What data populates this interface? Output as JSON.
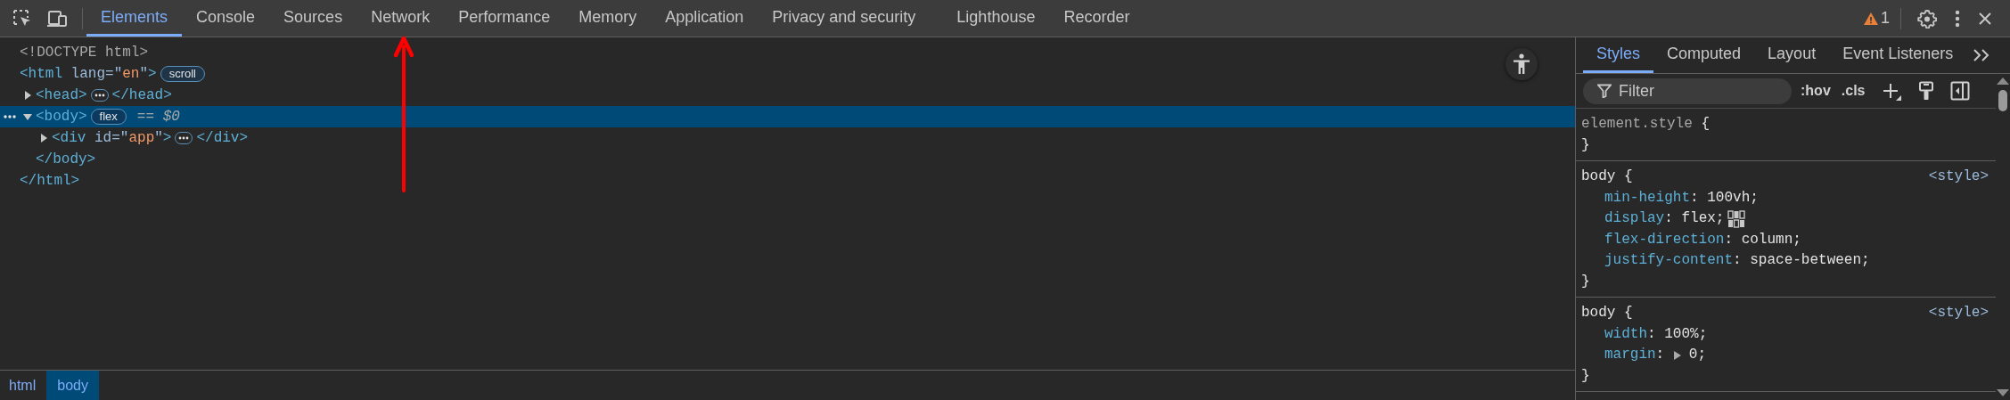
{
  "toolbar": {
    "tabs": [
      {
        "label": "Elements",
        "selected": true
      },
      {
        "label": "Console",
        "selected": false
      },
      {
        "label": "Sources",
        "selected": false
      },
      {
        "label": "Network",
        "selected": false
      },
      {
        "label": "Performance",
        "selected": false
      },
      {
        "label": "Memory",
        "selected": false
      },
      {
        "label": "Application",
        "selected": false
      },
      {
        "label": "Privacy and security",
        "selected": false
      },
      {
        "label": "Lighthouse",
        "selected": false
      },
      {
        "label": "Recorder",
        "selected": false
      }
    ],
    "issues": "1"
  },
  "dom_tree": [
    {
      "items": [
        {
          "kind": "code",
          "segments": [
            {
              "kind": "comment",
              "text": "<!DOCTYPE html>"
            }
          ]
        }
      ],
      "selected": false
    },
    {
      "items": [
        {
          "kind": "code",
          "segments": [
            {
              "kind": "tag",
              "text": "<html"
            },
            {
              "kind": "attr",
              "text": " lang"
            },
            {
              "kind": "punct",
              "text": "=\""
            },
            {
              "kind": "value",
              "text": "en"
            },
            {
              "kind": "punct",
              "text": "\""
            },
            {
              "kind": "tag",
              "text": ">"
            }
          ]
        },
        {
          "kind": "badge",
          "text": "scroll"
        }
      ],
      "selected": false,
      "children": [
        {
          "expanded": false,
          "selected": false,
          "items": [
            {
              "kind": "code",
              "segments": [
                {
                  "kind": "tag",
                  "text": "<head>"
                }
              ]
            },
            {
              "kind": "ellipsis"
            },
            {
              "kind": "code",
              "segments": [
                {
                  "kind": "tag",
                  "text": "</head>"
                }
              ]
            }
          ]
        },
        {
          "expanded": true,
          "selected": true,
          "items": [
            {
              "kind": "code",
              "segments": [
                {
                  "kind": "tag",
                  "text": "<body>"
                }
              ]
            },
            {
              "kind": "badge",
              "text": "flex"
            },
            {
              "kind": "ref",
              "text": "== $0"
            }
          ],
          "children": [
            {
              "expanded": false,
              "selected": false,
              "items": [
                {
                  "kind": "code",
                  "segments": [
                    {
                      "kind": "tag",
                      "text": "<div"
                    },
                    {
                      "kind": "attr",
                      "text": " id"
                    },
                    {
                      "kind": "punct",
                      "text": "=\""
                    },
                    {
                      "kind": "value",
                      "text": "app"
                    },
                    {
                      "kind": "punct",
                      "text": "\""
                    },
                    {
                      "kind": "tag",
                      "text": ">"
                    }
                  ]
                },
                {
                  "kind": "ellipsis"
                },
                {
                  "kind": "code",
                  "segments": [
                    {
                      "kind": "tag",
                      "text": "</div>"
                    }
                  ]
                }
              ]
            }
          ],
          "closing": [
            {
              "kind": "tag",
              "text": "</body>"
            }
          ]
        }
      ],
      "closing": [
        {
          "kind": "tag",
          "text": "</html>"
        }
      ]
    }
  ],
  "breadcrumbs": [
    {
      "label": "html",
      "selected": false
    },
    {
      "label": "body",
      "selected": true
    }
  ],
  "sidebar": {
    "tabs": [
      {
        "label": "Styles",
        "selected": true
      },
      {
        "label": "Computed",
        "selected": false
      },
      {
        "label": "Layout",
        "selected": false
      },
      {
        "label": "Event Listeners",
        "selected": false
      }
    ],
    "filter": {
      "placeholder": "Filter"
    },
    "toggles": [
      ":hov",
      ".cls"
    ],
    "rules": [
      {
        "kind": "inline",
        "selector": "element.style",
        "open": "{",
        "close": "}"
      },
      {
        "kind": "sheet",
        "selector": "body",
        "open": "{",
        "close": "}",
        "source": "<style>",
        "declarations": [
          {
            "kind": "plain",
            "property": "min-height",
            "colon": ":",
            "value": "100vh;"
          },
          {
            "kind": "flex",
            "property": "display",
            "colon": ":",
            "value": "flex;"
          },
          {
            "kind": "plain",
            "property": "flex-direction",
            "colon": ":",
            "value": "column;"
          },
          {
            "kind": "plain",
            "property": "justify-content",
            "colon": ":",
            "value": "space-between;"
          }
        ]
      },
      {
        "kind": "sheet",
        "selector": "body",
        "open": "{",
        "close": "}",
        "source": "<style>",
        "declarations": [
          {
            "kind": "plain",
            "property": "width",
            "colon": ":",
            "value": "100%;"
          },
          {
            "kind": "shorthand",
            "property": "margin",
            "colon": ":",
            "value": "0;"
          }
        ]
      }
    ]
  },
  "annotations": [
    {
      "kind": "arrow",
      "color": "#ff0000"
    }
  ]
}
